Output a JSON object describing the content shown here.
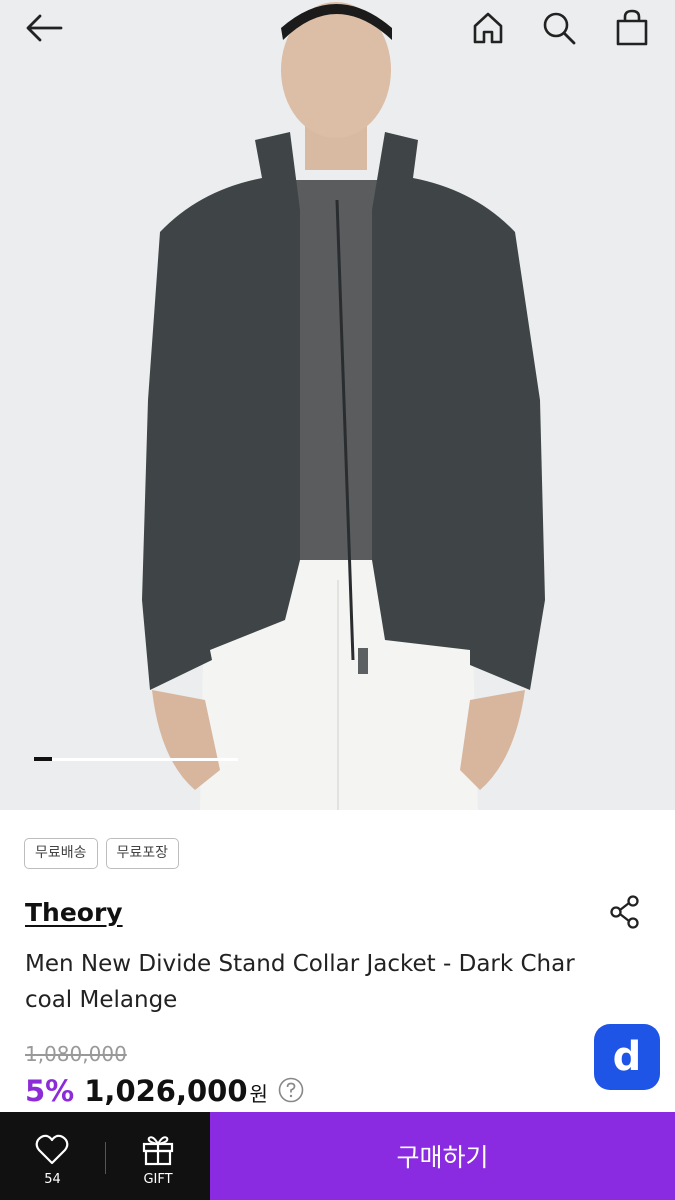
{
  "header": {
    "back_icon": "arrow-left-icon",
    "home_icon": "home-icon",
    "search_icon": "search-icon",
    "bag_icon": "shopping-bag-icon"
  },
  "gallery": {
    "image_subject": "jacket-photo",
    "progress": 0.09
  },
  "tags": [
    "무료배송",
    "무료포장"
  ],
  "product": {
    "brand": "Theory",
    "title": "Men New Divide Stand Collar Jacket - Dark Charcoal Melange",
    "original_price": "1,080,000",
    "discount": "5%",
    "price": "1,026,000",
    "currency": "원"
  },
  "badge": {
    "label": "d"
  },
  "bottom_bar": {
    "like_count": "54",
    "gift_label": "GIFT",
    "buy_label": "구매하기"
  },
  "colors": {
    "accent": "#8a2be2",
    "discount": "#8c2bd8",
    "badge": "#1f55e6",
    "bar": "#111111"
  }
}
